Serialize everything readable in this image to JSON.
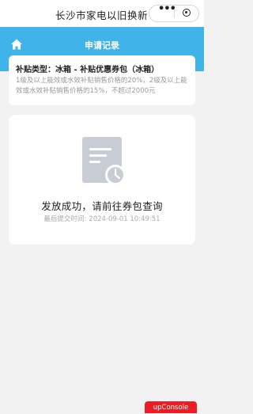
{
  "app": {
    "title": "长沙市家电以旧换新",
    "menu_more_icon": "more-dots-icon",
    "menu_close_icon": "close-circle-icon"
  },
  "header": {
    "title": "申请记录",
    "home_icon": "home-icon",
    "bg_color": "#40b3e8"
  },
  "subsidy": {
    "type_text": "补贴类型：冰箱 - 补贴优惠券包（冰箱）",
    "description": "1级及以上能效或水效补贴销售价格的20%，2级及以上能效或水效补贴销售价格的15%，不超过2000元"
  },
  "status": {
    "icon": "document-clock-icon",
    "message": "发放成功，请前往券包查询",
    "time_label": "最后提交时间:",
    "time_value": "2024-09-01 10:49:51"
  },
  "console": {
    "label": "upConsole",
    "color": "#ee1c25"
  }
}
